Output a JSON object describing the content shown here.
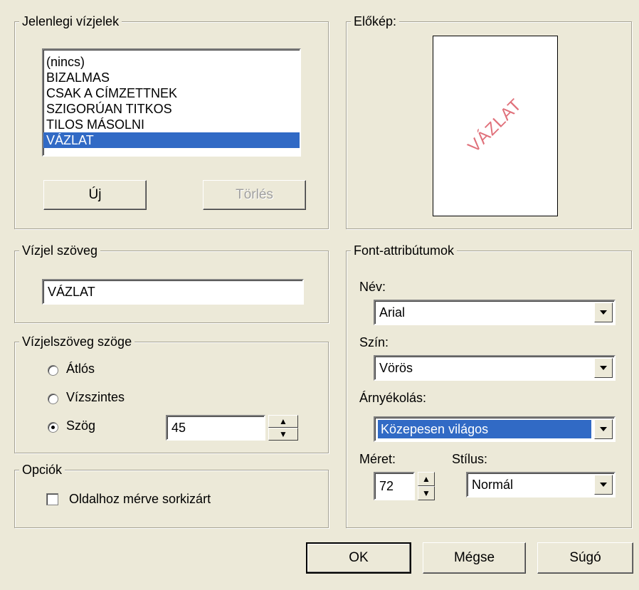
{
  "current_watermarks": {
    "legend": "Jelenlegi vízjelek",
    "items": [
      "(nincs)",
      "BIZALMAS",
      "CSAK A CÍMZETTNEK",
      "SZIGORÚAN TITKOS",
      "TILOS MÁSOLNI",
      "VÁZLAT"
    ],
    "selected_index": 5,
    "new_button": "Új",
    "delete_button": "Törlés"
  },
  "preview": {
    "legend": "Előkép:",
    "watermark_text": "VÁZLAT"
  },
  "watermark_text": {
    "legend": "Vízjel szöveg",
    "value": "VÁZLAT"
  },
  "angle": {
    "legend": "Vízjelszöveg szöge",
    "diagonal": "Átlós",
    "horizontal": "Vízszintes",
    "custom": "Szög",
    "value": "45",
    "selected": "custom"
  },
  "options": {
    "legend": "Opciók",
    "fit_to_page": "Oldalhoz mérve sorkizárt",
    "fit_to_page_checked": false
  },
  "font": {
    "legend": "Font-attribútumok",
    "name_label": "Név:",
    "name_value": "Arial",
    "color_label": "Szín:",
    "color_value": "Vörös",
    "shading_label": "Árnyékolás:",
    "shading_value": "Közepesen világos",
    "size_label": "Méret:",
    "size_value": "72",
    "style_label": "Stílus:",
    "style_value": "Normál"
  },
  "buttons": {
    "ok": "OK",
    "cancel": "Mégse",
    "help": "Súgó"
  },
  "colors": {
    "selection": "#316ac5",
    "watermark": "#e0707a",
    "face": "#ece9d8"
  }
}
